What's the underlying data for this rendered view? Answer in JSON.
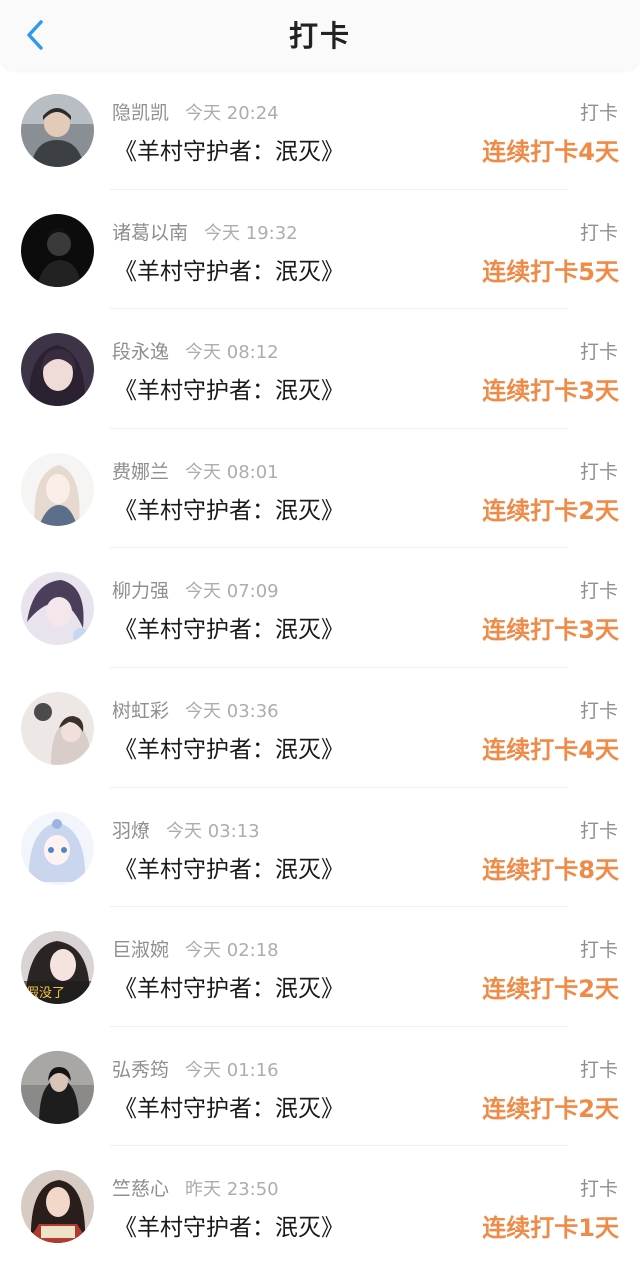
{
  "header": {
    "title": "打卡",
    "back_icon": "chevron-left-icon"
  },
  "colors": {
    "accent_blue": "#2f9ae8",
    "streak_orange": "#f08a47",
    "name_gray": "#8f8f8f",
    "time_gray": "#adadad"
  },
  "rows": [
    {
      "name": "隐凯凯",
      "time": "今天 20:24",
      "book": "《羊村守护者：泯灭》",
      "label": "打卡",
      "streak": "连续打卡4天"
    },
    {
      "name": "诸葛以南",
      "time": "今天 19:32",
      "book": "《羊村守护者：泯灭》",
      "label": "打卡",
      "streak": "连续打卡5天"
    },
    {
      "name": "段永逸",
      "time": "今天 08:12",
      "book": "《羊村守护者：泯灭》",
      "label": "打卡",
      "streak": "连续打卡3天"
    },
    {
      "name": "费娜兰",
      "time": "今天 08:01",
      "book": "《羊村守护者：泯灭》",
      "label": "打卡",
      "streak": "连续打卡2天"
    },
    {
      "name": "柳力强",
      "time": "今天 07:09",
      "book": "《羊村守护者：泯灭》",
      "label": "打卡",
      "streak": "连续打卡3天"
    },
    {
      "name": "树虹彩",
      "time": "今天 03:36",
      "book": "《羊村守护者：泯灭》",
      "label": "打卡",
      "streak": "连续打卡4天"
    },
    {
      "name": "羽燎",
      "time": "今天 03:13",
      "book": "《羊村守护者：泯灭》",
      "label": "打卡",
      "streak": "连续打卡8天"
    },
    {
      "name": "巨淑婉",
      "time": "今天 02:18",
      "book": "《羊村守护者：泯灭》",
      "label": "打卡",
      "streak": "连续打卡2天",
      "avatar_text": "假没了"
    },
    {
      "name": "弘秀筠",
      "time": "今天 01:16",
      "book": "《羊村守护者：泯灭》",
      "label": "打卡",
      "streak": "连续打卡2天"
    },
    {
      "name": "竺慈心",
      "time": "昨天 23:50",
      "book": "《羊村守护者：泯灭》",
      "label": "打卡",
      "streak": "连续打卡1天"
    }
  ]
}
